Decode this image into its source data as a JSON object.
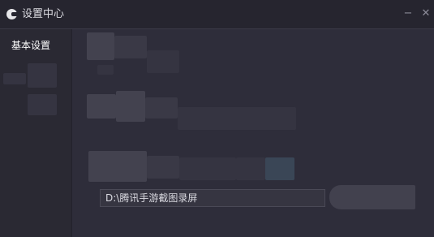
{
  "window": {
    "title": "设置中心",
    "minimize_symbol": "−",
    "close_symbol": "✕"
  },
  "sidebar": {
    "items": [
      {
        "label": "基本设置",
        "active": true
      }
    ]
  },
  "main": {
    "save_path": {
      "value": "D:\\腾讯手游截图录屏"
    }
  },
  "icons": {
    "app_logo": "app-logo-icon"
  },
  "colors": {
    "background": "#2e2d3a",
    "titlebar": "#26252f",
    "sidebar": "#2a2933",
    "text_primary": "#ffffff",
    "text_secondary": "#dcdce2"
  }
}
